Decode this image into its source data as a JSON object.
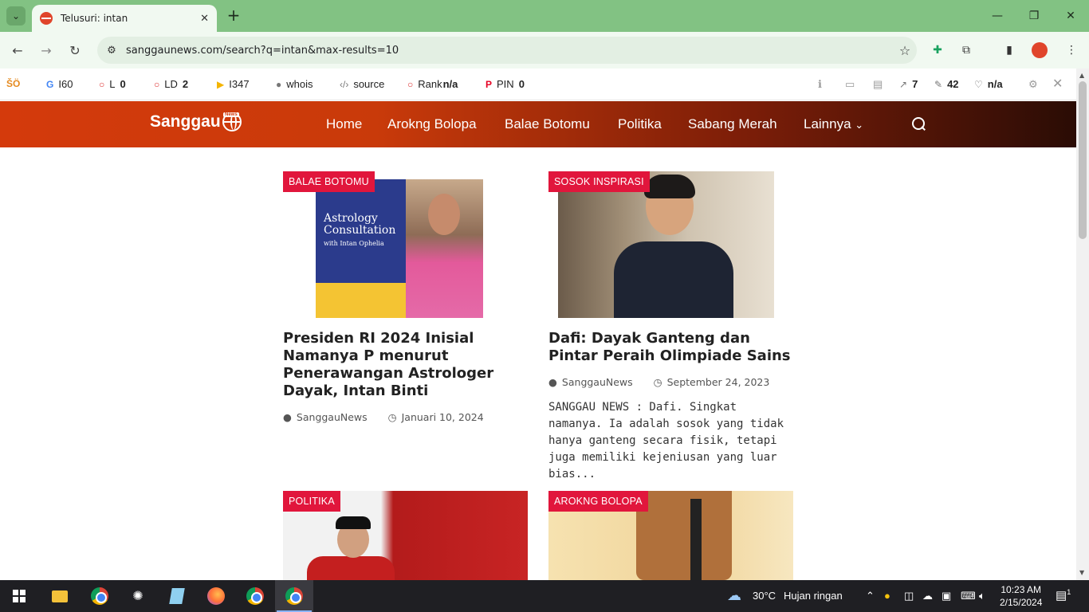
{
  "browser": {
    "tab_title": "Telusuri: intan",
    "url": "sanggaunews.com/search?q=intan&max-results=10"
  },
  "extensions": {
    "items": [
      {
        "icon": "seo-icon",
        "label": "",
        "value": ""
      },
      {
        "icon": "google-icon",
        "label": "I",
        "value": "60"
      },
      {
        "icon": "circle-icon",
        "label": "L",
        "value": "0"
      },
      {
        "icon": "circle-icon",
        "label": "LD",
        "value": "2"
      },
      {
        "icon": "bing-icon",
        "label": "I",
        "value": "347"
      },
      {
        "icon": "user-icon",
        "label": "whois",
        "value": ""
      },
      {
        "icon": "code-icon",
        "label": "source",
        "value": ""
      },
      {
        "icon": "circle-icon",
        "label": "Rank",
        "value": "n/a"
      },
      {
        "icon": "pinterest-icon",
        "label": "PIN",
        "value": "0"
      }
    ],
    "right": [
      {
        "icon": "info-icon",
        "value": ""
      },
      {
        "icon": "monitor-icon",
        "value": ""
      },
      {
        "icon": "doc-icon",
        "value": ""
      },
      {
        "icon": "external-link-icon",
        "value": "7"
      },
      {
        "icon": "edit-icon",
        "value": "42"
      },
      {
        "icon": "heart-icon",
        "value": "n/a"
      }
    ]
  },
  "site": {
    "logo": "Sanggau",
    "logo_badge": "News",
    "menu": [
      "Home",
      "Arokng Bolopa",
      "Balae Botomu",
      "Politika",
      "Sabang Merah",
      "Lainnya"
    ]
  },
  "posts": [
    {
      "category": "BALAE BOTOMU",
      "title": "Presiden RI 2024 Inisial Namanya P menurut Penerawangan Astrologer Dayak, Intan Binti",
      "author": "SanggauNews",
      "date": "Januari 10, 2024",
      "excerpt": "",
      "img_text1": "Astrology Consultation",
      "img_text2": "with Intan Ophelia"
    },
    {
      "category": "SOSOK INSPIRASI",
      "title": "Dafi: Dayak Ganteng dan Pintar Peraih Olimpiade Sains",
      "author": "SanggauNews",
      "date": "September 24, 2023",
      "excerpt": "SANGGAU NEWS : Dafi. Singkat namanya. Ia adalah sosok yang tidak hanya ganteng secara fisik, tetapi juga memiliki kejeniusan yang luar bias..."
    },
    {
      "category": "POLITIKA"
    },
    {
      "category": "AROKNG BOLOPA"
    }
  ],
  "taskbar": {
    "weather_temp": "30°C",
    "weather_desc": "Hujan ringan",
    "time": "10:23 AM",
    "date": "2/15/2024",
    "notif_count": "1"
  }
}
